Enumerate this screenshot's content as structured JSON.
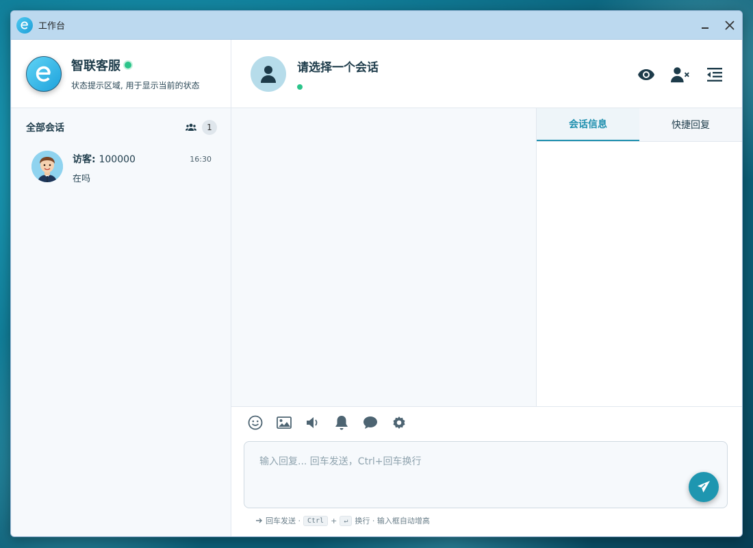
{
  "window": {
    "title": "工作台"
  },
  "profile": {
    "name": "智联客服",
    "status_text": "状态提示区域, 用于显示当前的状态"
  },
  "conversations": {
    "header": "全部会话",
    "count": "1",
    "items": [
      {
        "name_prefix": "访客: ",
        "name_id": "100000",
        "time": "16:30",
        "last_message": "在吗"
      }
    ]
  },
  "chat": {
    "title": "请选择一个会话"
  },
  "info_panel": {
    "tabs": [
      "会话信息",
      "快捷回复"
    ],
    "active_tab": 0
  },
  "composer": {
    "placeholder": "输入回复... 回车发送，Ctrl+回车换行",
    "hint": {
      "send": "回车发送 ·",
      "key_ctrl": "Ctrl",
      "plus": "+",
      "key_enter": "↵",
      "newline": "换行 · 输入框自动增高"
    }
  },
  "colors": {
    "accent": "#1e96b0",
    "online": "#2bc48a",
    "titlebar": "#bcd9ef"
  },
  "icons": [
    "app-logo-icon",
    "minimize-icon",
    "close-icon",
    "users-icon",
    "user-icon",
    "eye-icon",
    "remove-user-icon",
    "collapse-panel-icon",
    "emoji-icon",
    "image-icon",
    "volume-icon",
    "bell-icon",
    "comment-icon",
    "settings-icon",
    "send-icon",
    "arrow-right-icon"
  ]
}
